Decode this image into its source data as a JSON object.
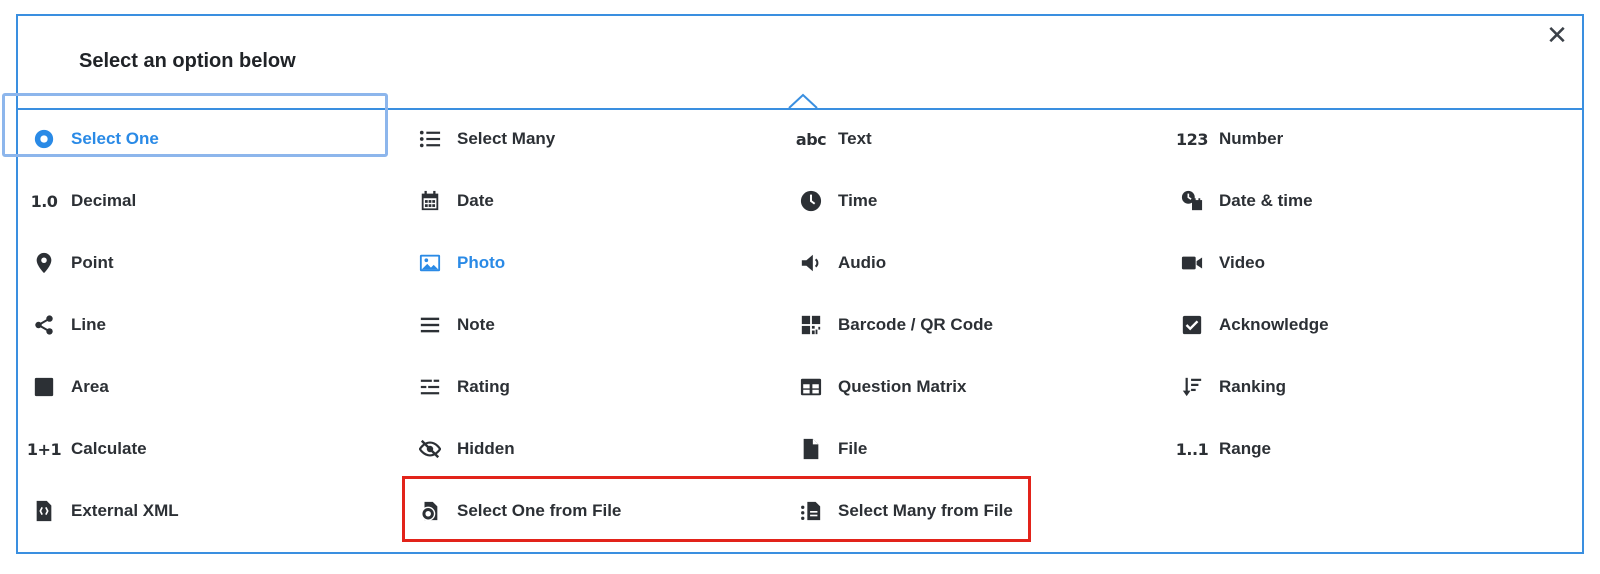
{
  "dialog": {
    "title": "Select an option below",
    "close_icon": "✕",
    "accent_color": "#2a8ae6",
    "highlight_color": "#e2231a"
  },
  "options": [
    {
      "label": "Select One",
      "icon": "radio-dot-icon"
    },
    {
      "label": "Select Many",
      "icon": "list-icon"
    },
    {
      "label": "Text",
      "icon": "abc-icon",
      "icon_text": "abc"
    },
    {
      "label": "Number",
      "icon": "number-icon",
      "icon_text": "123"
    },
    {
      "label": "Decimal",
      "icon": "decimal-icon",
      "icon_text": "1.0"
    },
    {
      "label": "Date",
      "icon": "calendar-icon"
    },
    {
      "label": "Time",
      "icon": "clock-icon"
    },
    {
      "label": "Date & time",
      "icon": "date-time-icon"
    },
    {
      "label": "Point",
      "icon": "map-pin-icon"
    },
    {
      "label": "Photo",
      "icon": "image-icon"
    },
    {
      "label": "Audio",
      "icon": "speaker-icon"
    },
    {
      "label": "Video",
      "icon": "video-camera-icon"
    },
    {
      "label": "Line",
      "icon": "share-nodes-icon"
    },
    {
      "label": "Note",
      "icon": "lines-icon"
    },
    {
      "label": "Barcode / QR Code",
      "icon": "qr-code-icon"
    },
    {
      "label": "Acknowledge",
      "icon": "checkbox-icon"
    },
    {
      "label": "Area",
      "icon": "square-icon"
    },
    {
      "label": "Rating",
      "icon": "rating-icon"
    },
    {
      "label": "Question Matrix",
      "icon": "table-icon"
    },
    {
      "label": "Ranking",
      "icon": "sort-icon"
    },
    {
      "label": "Calculate",
      "icon": "calculate-icon",
      "icon_text": "1+1"
    },
    {
      "label": "Hidden",
      "icon": "eye-slash-icon"
    },
    {
      "label": "File",
      "icon": "file-icon"
    },
    {
      "label": "Range",
      "icon": "range-icon",
      "icon_text": "1..1"
    },
    {
      "label": "External XML",
      "icon": "xml-file-icon"
    },
    {
      "label": "Select One from File",
      "icon": "file-select-one-icon"
    },
    {
      "label": "Select Many from File",
      "icon": "file-select-many-icon"
    }
  ]
}
